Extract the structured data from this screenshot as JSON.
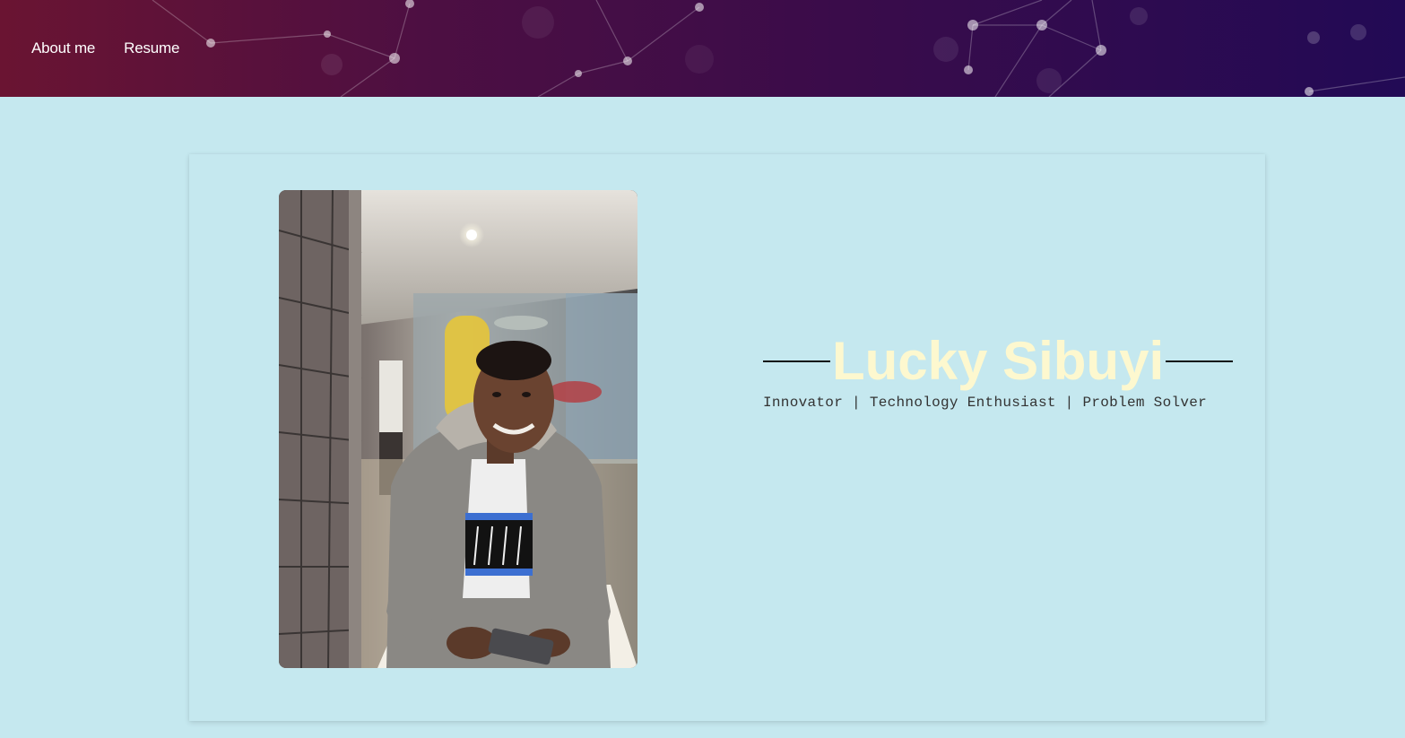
{
  "nav": {
    "items": [
      {
        "label": "About me"
      },
      {
        "label": "Resume"
      }
    ]
  },
  "profile": {
    "name": "Lucky Sibuyi",
    "tagline": "Innovator | Technology Enthusiast | Problem Solver"
  },
  "colors": {
    "page_background": "#c5e8ef",
    "name_color": "#fdf8cf",
    "header_gradient_start": "#6a1432",
    "header_gradient_end": "#220a55"
  },
  "icons": {
    "header_background": "network-constellation-graphic",
    "profile_photo": "portrait-photo"
  }
}
